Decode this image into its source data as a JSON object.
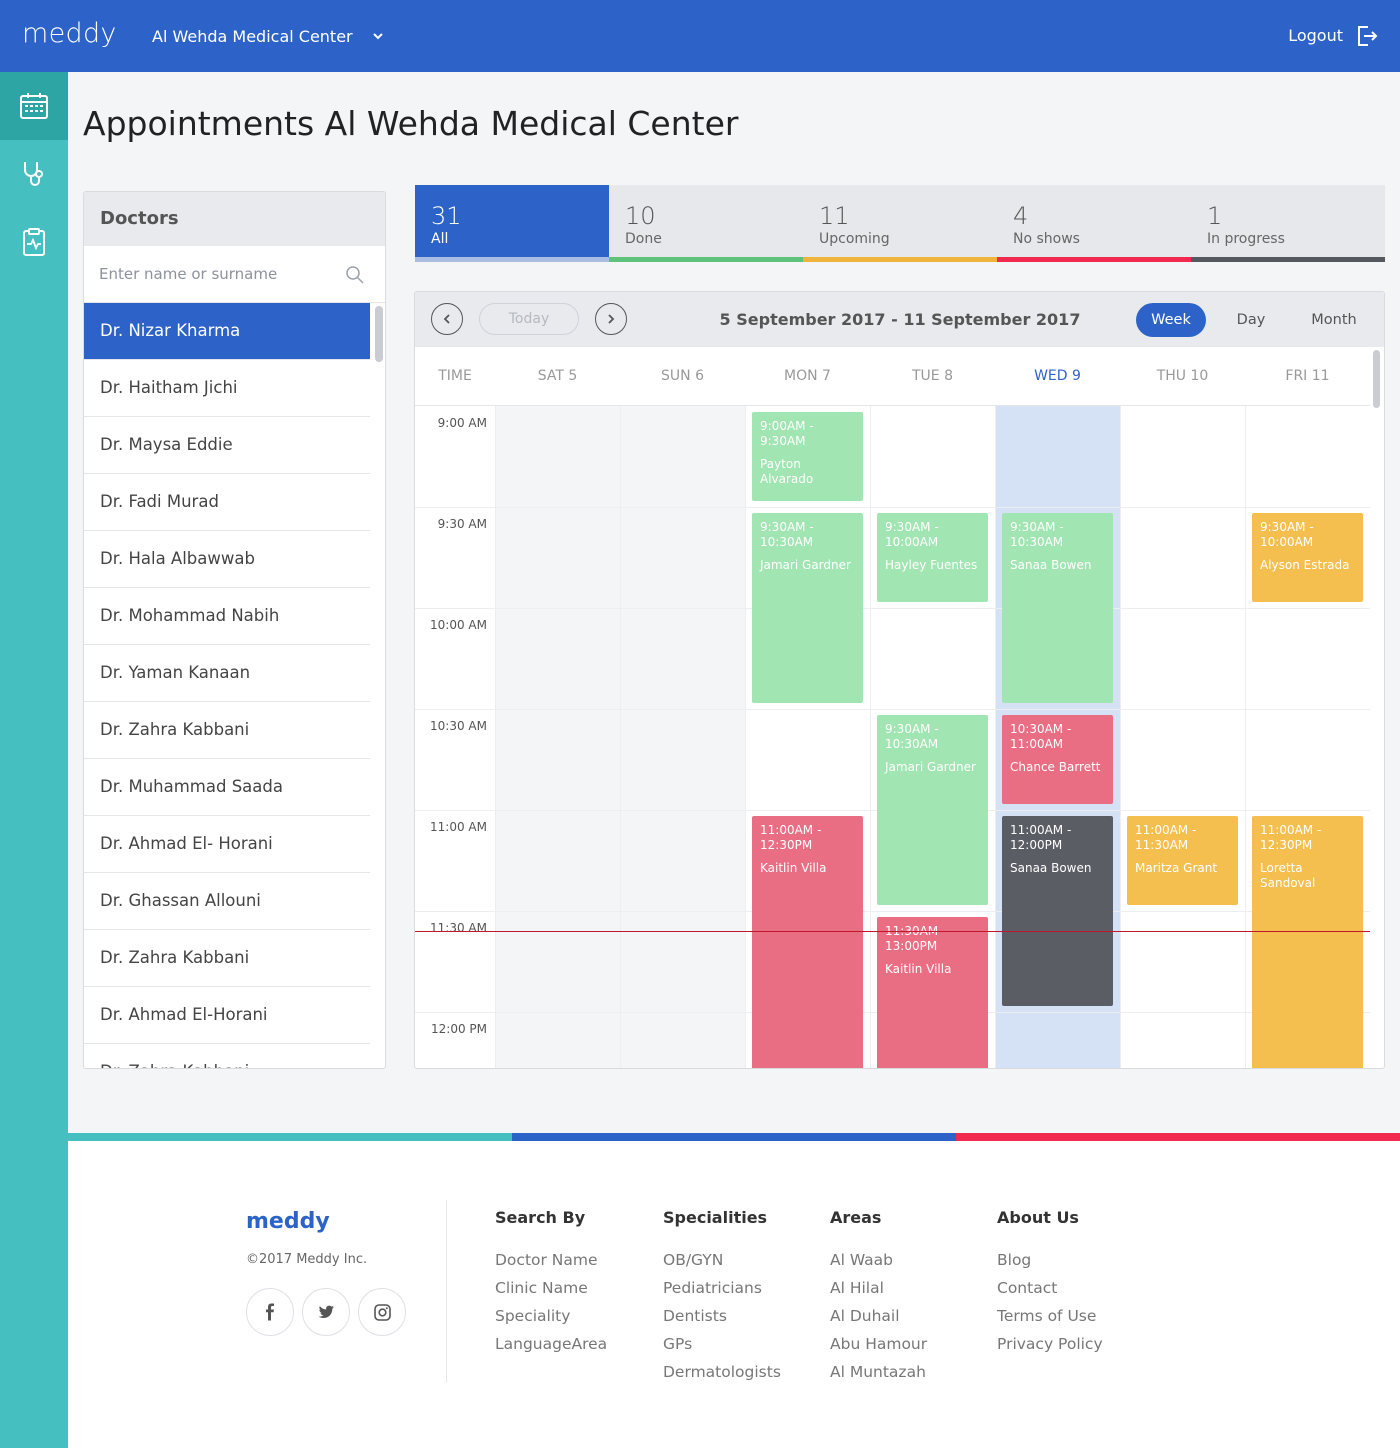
{
  "header": {
    "logo": "meddy",
    "clinic_name": "Al Wehda Medical Center",
    "logout_label": "Logout"
  },
  "sidebar": {
    "items": [
      {
        "icon": "calendar-icon",
        "active": true
      },
      {
        "icon": "stethoscope-icon",
        "active": false
      },
      {
        "icon": "clipboard-icon",
        "active": false
      }
    ]
  },
  "page_title": "Appointments Al Wehda Medical Center",
  "doctors_panel": {
    "title": "Doctors",
    "search_placeholder": "Enter name or surname",
    "doctors": [
      "Dr. Nizar Kharma",
      "Dr. Haitham Jichi",
      "Dr. Maysa Eddie",
      "Dr. Fadi Murad",
      "Dr. Hala Albawwab",
      "Dr. Mohammad Nabih",
      "Dr. Yaman Kanaan",
      "Dr. Zahra Kabbani",
      "Dr. Muhammad Saada",
      "Dr. Ahmad El- Horani",
      "Dr. Ghassan Allouni",
      "Dr. Zahra Kabbani",
      "Dr. Ahmad El-Horani",
      "Dr. Zahra Kabbani"
    ],
    "selected_index": 0
  },
  "stats": [
    {
      "count": "31",
      "label": "All",
      "color": "#2d63c8",
      "bar_color": "#a9bde3"
    },
    {
      "count": "10",
      "label": "Done",
      "color": "#5ec27a",
      "bar_color": "#5ec27a"
    },
    {
      "count": "11",
      "label": "Upcoming",
      "color": "#f0b43c",
      "bar_color": "#f0b43c"
    },
    {
      "count": "4",
      "label": "No shows",
      "color": "#f2294e",
      "bar_color": "#f2294e"
    },
    {
      "count": "1",
      "label": "In progress",
      "color": "#55585e",
      "bar_color": "#55585e"
    }
  ],
  "calendar": {
    "today_label": "Today",
    "range": "5 September 2017 - 11 September 2017",
    "views": [
      "Week",
      "Day",
      "Month"
    ],
    "active_view": "Week",
    "time_header": "TIME",
    "days": [
      {
        "label": "SAT 5",
        "kind": "weekend"
      },
      {
        "label": "SUN 6",
        "kind": "weekend"
      },
      {
        "label": "MON 7",
        "kind": "normal"
      },
      {
        "label": "TUE 8",
        "kind": "normal"
      },
      {
        "label": "WED 9",
        "kind": "today"
      },
      {
        "label": "THU 10",
        "kind": "normal"
      },
      {
        "label": "FRI 11",
        "kind": "normal"
      }
    ],
    "times": [
      "9:00 AM",
      "9:30 AM",
      "10:00 AM",
      "10:30 AM",
      "11:00 AM",
      "11:30 AM",
      "12:00 PM"
    ],
    "current_time_hour": 11.6,
    "events": [
      {
        "day": 2,
        "start": 9.0,
        "end": 9.5,
        "time": "9:00AM - 9:30AM",
        "patient": "Payton Alvarado",
        "status": "green"
      },
      {
        "day": 2,
        "start": 9.5,
        "end": 10.5,
        "time": "9:30AM - 10:30AM",
        "patient": "Jamari Gardner",
        "status": "green"
      },
      {
        "day": 2,
        "start": 11.0,
        "end": 12.5,
        "time": "11:00AM - 12:30PM",
        "patient": "Kaitlin Villa",
        "status": "red"
      },
      {
        "day": 3,
        "start": 9.5,
        "end": 10.0,
        "time": "9:30AM - 10:00AM",
        "patient": "Hayley Fuentes",
        "status": "green"
      },
      {
        "day": 3,
        "start": 10.5,
        "end": 11.5,
        "time": "9:30AM - 10:30AM",
        "patient": "Jamari Gardner",
        "status": "green"
      },
      {
        "day": 3,
        "start": 11.5,
        "end": 13.0,
        "time": "11:30AM - 13:00PM",
        "patient": "Kaitlin Villa",
        "status": "red"
      },
      {
        "day": 4,
        "start": 9.5,
        "end": 10.5,
        "time": "9:30AM - 10:30AM",
        "patient": "Sanaa Bowen",
        "status": "green"
      },
      {
        "day": 4,
        "start": 10.5,
        "end": 11.0,
        "time": "10:30AM - 11:00AM",
        "patient": "Chance Barrett",
        "status": "red"
      },
      {
        "day": 4,
        "start": 11.0,
        "end": 12.0,
        "time": "11:00AM - 12:00PM",
        "patient": "Sanaa Bowen",
        "status": "dark"
      },
      {
        "day": 5,
        "start": 11.0,
        "end": 11.5,
        "time": "11:00AM - 11:30AM",
        "patient": "Maritza Grant",
        "status": "yellow"
      },
      {
        "day": 6,
        "start": 9.5,
        "end": 10.0,
        "time": "9:30AM - 10:00AM",
        "patient": "Alyson Estrada",
        "status": "yellow"
      },
      {
        "day": 6,
        "start": 11.0,
        "end": 12.5,
        "time": "11:00AM - 12:30PM",
        "patient": "Loretta Sandoval",
        "status": "yellow"
      }
    ]
  },
  "band_colors": [
    "#45bfbf",
    "#2d63c8",
    "#f2294e"
  ],
  "footer": {
    "logo": "meddy",
    "copyright": "©2017 Meddy Inc.",
    "social": [
      "facebook-icon",
      "twitter-icon",
      "instagram-icon"
    ],
    "columns": [
      {
        "title": "Search By",
        "links": [
          "Doctor Name",
          "Clinic Name",
          "Speciality",
          "LanguageArea"
        ]
      },
      {
        "title": "Specialities",
        "links": [
          "OB/GYN",
          "Pediatricians",
          "Dentists",
          "GPs",
          "Dermatologists"
        ]
      },
      {
        "title": "Areas",
        "links": [
          "Al Waab",
          "Al Hilal",
          "Al Duhail",
          "Abu Hamour",
          "Al Muntazah"
        ]
      },
      {
        "title": "About Us",
        "links": [
          "Blog",
          "Contact",
          "Terms of Use",
          "Privacy Policy"
        ]
      }
    ]
  }
}
